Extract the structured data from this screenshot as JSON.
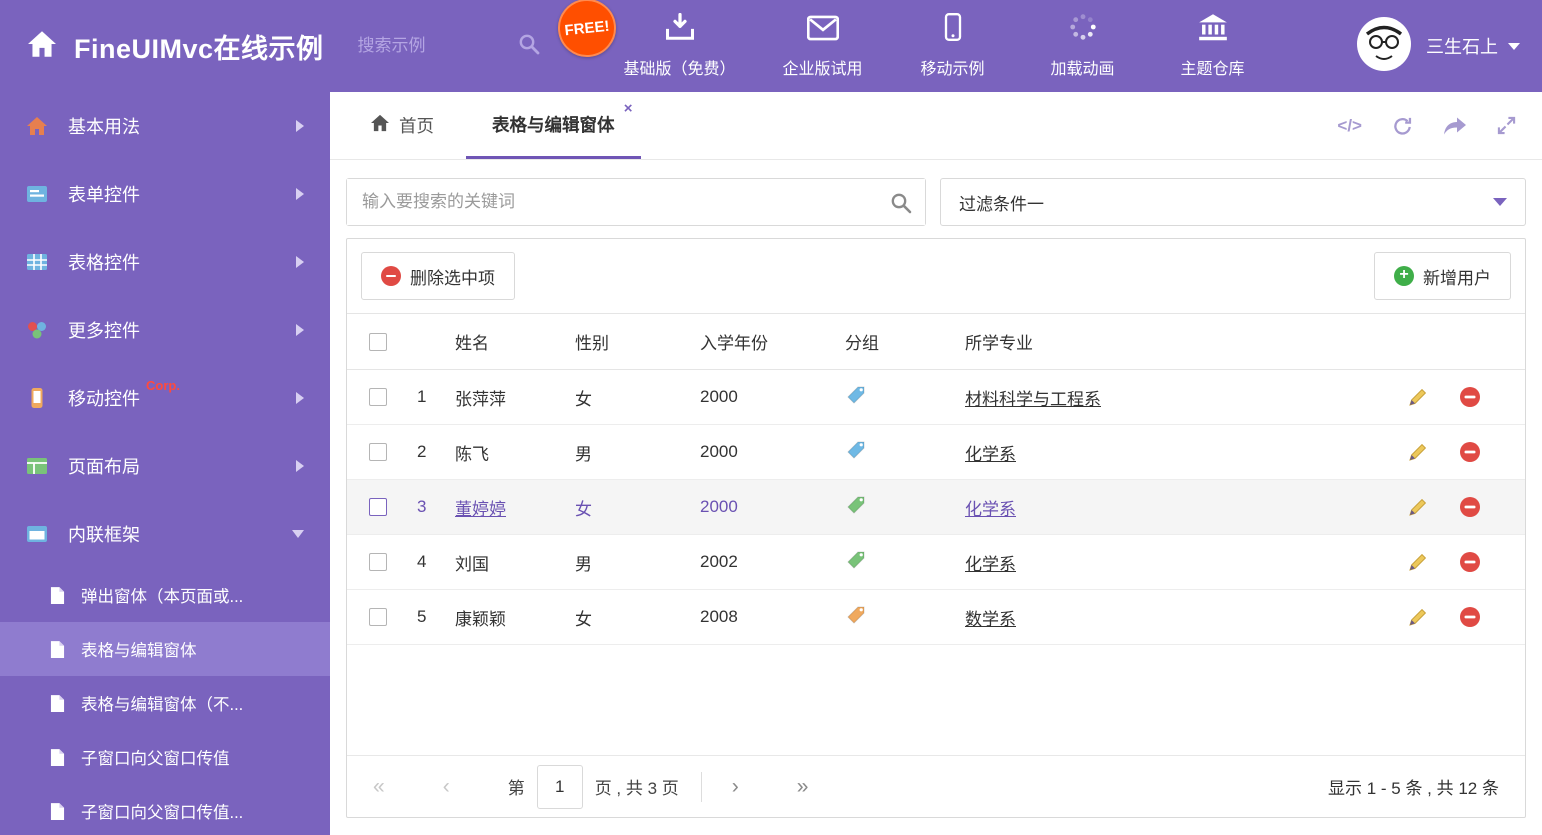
{
  "header": {
    "title": "FineUIMvc在线示例",
    "search_placeholder": "搜索示例",
    "free_badge": "FREE!",
    "nav_items": [
      {
        "label": "基础版（免费）"
      },
      {
        "label": "企业版试用"
      },
      {
        "label": "移动示例"
      },
      {
        "label": "加载动画"
      },
      {
        "label": "主题仓库"
      }
    ],
    "user_name": "三生石上"
  },
  "sidebar": {
    "items": [
      {
        "label": "基本用法"
      },
      {
        "label": "表单控件"
      },
      {
        "label": "表格控件"
      },
      {
        "label": "更多控件"
      },
      {
        "label": "移动控件",
        "badge": "Corp."
      },
      {
        "label": "页面布局"
      },
      {
        "label": "内联框架"
      }
    ],
    "subitems": [
      {
        "label": "弹出窗体（本页面或..."
      },
      {
        "label": "表格与编辑窗体"
      },
      {
        "label": "表格与编辑窗体（不..."
      },
      {
        "label": "子窗口向父窗口传值"
      },
      {
        "label": "子窗口向父窗口传值..."
      }
    ]
  },
  "tabs": {
    "home_label": "首页",
    "active_label": "表格与编辑窗体"
  },
  "filters": {
    "search_placeholder": "输入要搜索的关键词",
    "filter_value": "过滤条件一"
  },
  "toolbar": {
    "delete_label": "删除选中项",
    "add_label": "新增用户"
  },
  "table": {
    "columns": [
      "姓名",
      "性别",
      "入学年份",
      "分组",
      "所学专业"
    ],
    "rows": [
      {
        "num": "1",
        "name": "张萍萍",
        "gender": "女",
        "year": "2000",
        "tag_color": "#6FB9E5",
        "major": "材料科学与工程系"
      },
      {
        "num": "2",
        "name": "陈飞",
        "gender": "男",
        "year": "2000",
        "tag_color": "#6FB9E5",
        "major": "化学系"
      },
      {
        "num": "3",
        "name": "董婷婷",
        "gender": "女",
        "year": "2000",
        "tag_color": "#79C379",
        "major": "化学系"
      },
      {
        "num": "4",
        "name": "刘国",
        "gender": "男",
        "year": "2002",
        "tag_color": "#79C379",
        "major": "化学系"
      },
      {
        "num": "5",
        "name": "康颖颖",
        "gender": "女",
        "year": "2008",
        "tag_color": "#F0A95E",
        "major": "数学系"
      }
    ]
  },
  "pagination": {
    "prefix": "第",
    "page": "1",
    "suffix": "页 , 共 3 页",
    "summary": "显示 1 - 5 条 , 共 12 条"
  }
}
